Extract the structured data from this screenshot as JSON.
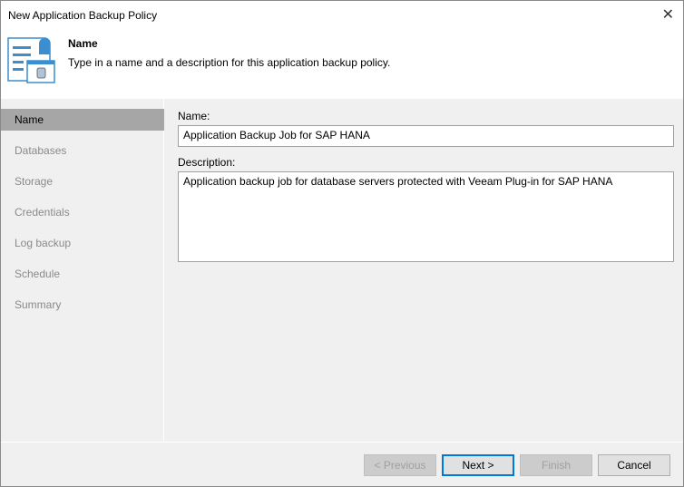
{
  "window": {
    "title": "New Application Backup Policy",
    "close_icon": "close-icon"
  },
  "header": {
    "title": "Name",
    "description": "Type in a name and a description for this application backup policy."
  },
  "sidebar": {
    "items": [
      {
        "label": "Name",
        "selected": true
      },
      {
        "label": "Databases"
      },
      {
        "label": "Storage"
      },
      {
        "label": "Credentials"
      },
      {
        "label": "Log backup"
      },
      {
        "label": "Schedule"
      },
      {
        "label": "Summary"
      }
    ]
  },
  "form": {
    "name_label": "Name:",
    "name_value": "Application Backup Job for SAP HANA",
    "description_label": "Description:",
    "description_value": "Application backup job for database servers protected with Veeam Plug-in for SAP HANA"
  },
  "buttons": {
    "previous": "< Previous",
    "next": "Next >",
    "finish": "Finish",
    "cancel": "Cancel"
  }
}
